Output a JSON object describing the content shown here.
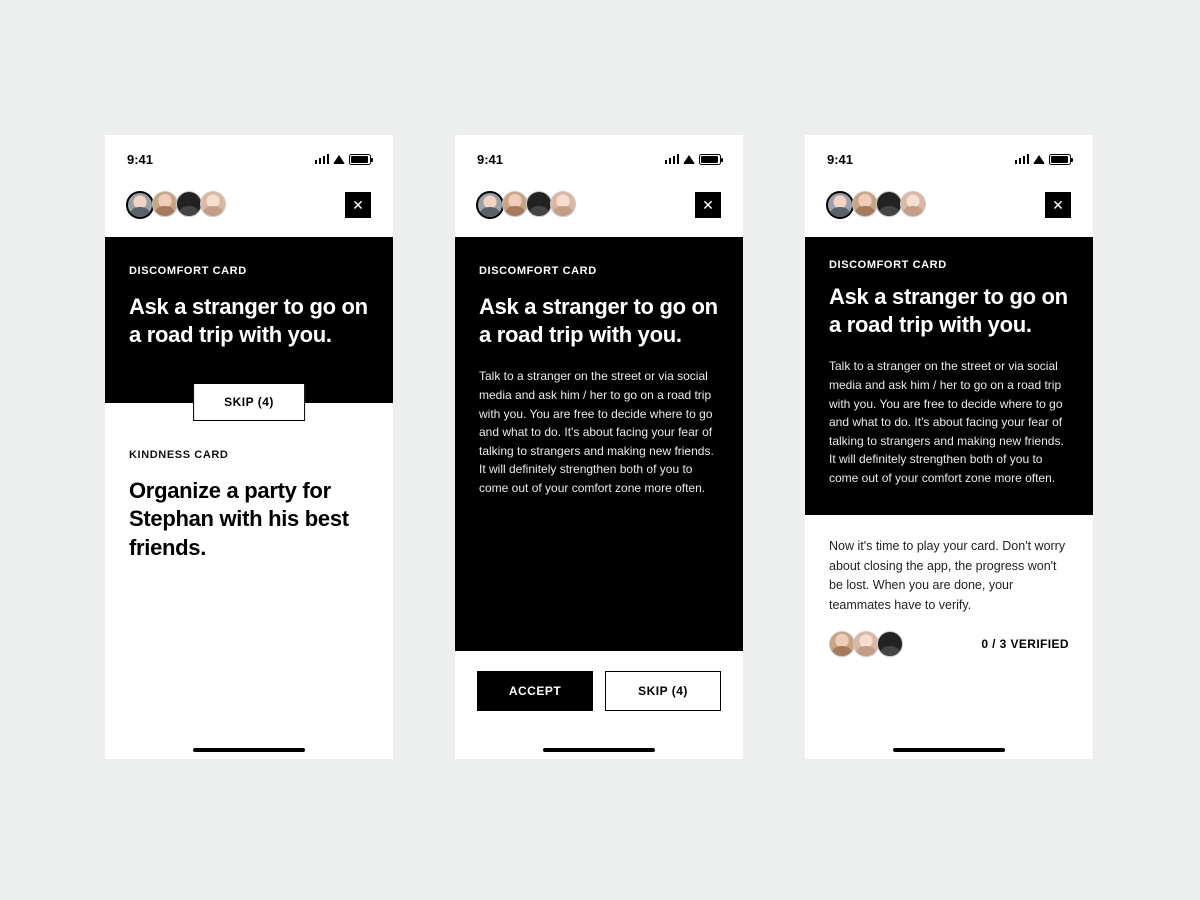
{
  "status": {
    "time": "9:41"
  },
  "screens": [
    {
      "card_label": "DISCOMFORT CARD",
      "card_title": "Ask a stranger to go on a road trip with you.",
      "skip_label": "SKIP (4)",
      "second_card_label": "KINDNESS CARD",
      "second_card_title": "Organize a party for Stephan with his best friends."
    },
    {
      "card_label": "DISCOMFORT CARD",
      "card_title": "Ask a stranger to go on a road trip with you.",
      "card_body": "Talk to a stranger on the street or via social media and ask him / her to go on a road trip with you. You are free to decide where to go and what to do. It's about facing your fear of talking to strangers and making new friends. It will definitely strengthen both of you to come out of your comfort zone more often.",
      "accept_label": "ACCEPT",
      "skip_label": "SKIP (4)"
    },
    {
      "card_label": "DISCOMFORT CARD",
      "card_title": "Ask a stranger to go on a road trip with you.",
      "card_body": "Talk to a stranger on the street or via social media and ask him / her to go on a road trip with you. You are free to decide where to go and what to do. It's about facing your fear of talking to strangers and making new friends. It will definitely strengthen both of you to come out of your comfort zone more often.",
      "play_note": "Now it's time to play your card. Don't worry about closing the app, the progress won't be lost. When you are done, your teammates have to verify.",
      "verified_text": "0 / 3 VERIFIED"
    }
  ]
}
